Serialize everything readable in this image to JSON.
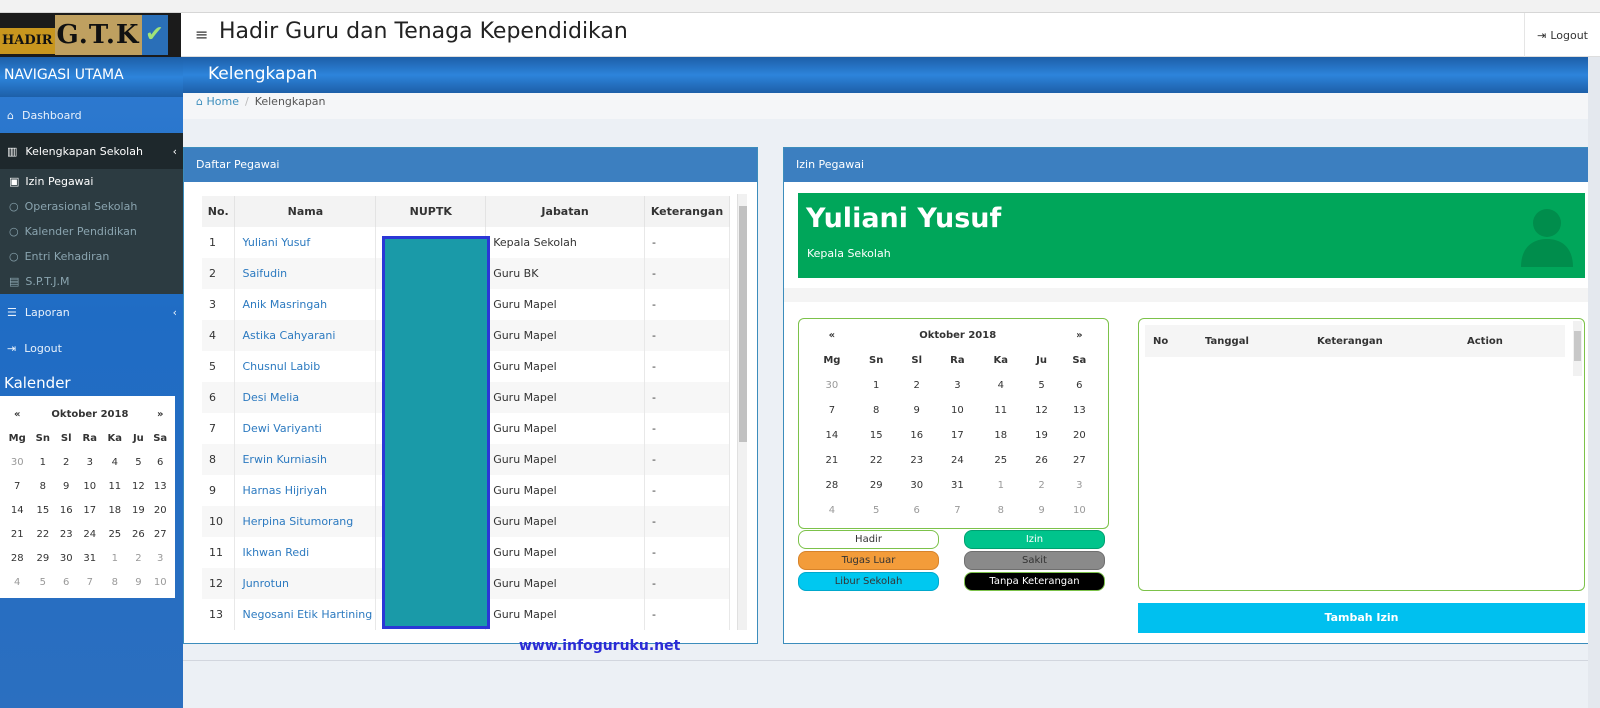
{
  "header": {
    "logo_text1": "HADIR",
    "logo_text2": "G.T.K",
    "title": "Hadir Guru dan Tenaga Kependidikan",
    "logout_label": "Logout"
  },
  "sidebar": {
    "nav_title": "NAVIGASI UTAMA",
    "items": [
      {
        "label": "Dashboard",
        "icon": "home-icon"
      },
      {
        "label": "Kelengkapan Sekolah",
        "icon": "bank-icon"
      },
      {
        "label": "Laporan",
        "icon": "list-icon"
      },
      {
        "label": "Logout",
        "icon": "sign-out-icon"
      }
    ],
    "subitems": [
      {
        "label": "Izin Pegawai",
        "icon": "calendar-check-icon"
      },
      {
        "label": "Operasional Sekolah",
        "icon": "circle-icon"
      },
      {
        "label": "Kalender Pendidikan",
        "icon": "circle-icon"
      },
      {
        "label": "Entri Kehadiran",
        "icon": "circle-icon"
      },
      {
        "label": "S.P.T.J.M",
        "icon": "file-icon"
      }
    ],
    "calendar_title": "Kalender"
  },
  "mini_calendar": {
    "prev": "«",
    "next": "»",
    "month": "Oktober 2018",
    "days": [
      "Mg",
      "Sn",
      "Sl",
      "Ra",
      "Ka",
      "Ju",
      "Sa"
    ],
    "weeks": [
      [
        "30",
        "1",
        "2",
        "3",
        "4",
        "5",
        "6"
      ],
      [
        "7",
        "8",
        "9",
        "10",
        "11",
        "12",
        "13"
      ],
      [
        "14",
        "15",
        "16",
        "17",
        "18",
        "19",
        "20"
      ],
      [
        "21",
        "22",
        "23",
        "24",
        "25",
        "26",
        "27"
      ],
      [
        "28",
        "29",
        "30",
        "31",
        "1",
        "2",
        "3"
      ],
      [
        "4",
        "5",
        "6",
        "7",
        "8",
        "9",
        "10"
      ]
    ]
  },
  "page": {
    "title": "Kelengkapan",
    "breadcrumb_home": "Home",
    "breadcrumb_current": "Kelengkapan"
  },
  "daftar": {
    "title": "Daftar Pegawai",
    "columns": [
      "No.",
      "Nama",
      "NUPTK",
      "Jabatan",
      "Keterangan"
    ],
    "rows": [
      [
        "1",
        "Yuliani Yusuf",
        "",
        "Kepala Sekolah",
        "-"
      ],
      [
        "2",
        "Saifudin",
        "",
        "Guru BK",
        "-"
      ],
      [
        "3",
        "Anik Masringah",
        "",
        "Guru Mapel",
        "-"
      ],
      [
        "4",
        "Astika Cahyarani",
        "",
        "Guru Mapel",
        "-"
      ],
      [
        "5",
        "Chusnul Labib",
        "",
        "Guru Mapel",
        "-"
      ],
      [
        "6",
        "Desi Melia",
        "",
        "Guru Mapel",
        "-"
      ],
      [
        "7",
        "Dewi Variyanti",
        "",
        "Guru Mapel",
        "-"
      ],
      [
        "8",
        "Erwin Kurniasih",
        "",
        "Guru Mapel",
        "-"
      ],
      [
        "9",
        "Harnas Hijriyah",
        "",
        "Guru Mapel",
        "-"
      ],
      [
        "10",
        "Herpina Situmorang",
        "",
        "Guru Mapel",
        "-"
      ],
      [
        "11",
        "Ikhwan Redi",
        "",
        "Guru Mapel",
        "-"
      ],
      [
        "12",
        "Junrotun",
        "",
        "Guru Mapel",
        "-"
      ],
      [
        "13",
        "Negosani Etik Hartining",
        "",
        "Guru Mapel",
        "-"
      ]
    ],
    "watermark": "www.infoguruku.net"
  },
  "izin": {
    "title": "Izin Pegawai",
    "profile_name": "Yuliani Yusuf",
    "profile_role": "Kepala Sekolah",
    "calendar": {
      "prev": "«",
      "next": "»",
      "month": "Oktober 2018",
      "days": [
        "Mg",
        "Sn",
        "Sl",
        "Ra",
        "Ka",
        "Ju",
        "Sa"
      ],
      "weeks": [
        [
          "30",
          "1",
          "2",
          "3",
          "4",
          "5",
          "6"
        ],
        [
          "7",
          "8",
          "9",
          "10",
          "11",
          "12",
          "13"
        ],
        [
          "14",
          "15",
          "16",
          "17",
          "18",
          "19",
          "20"
        ],
        [
          "21",
          "22",
          "23",
          "24",
          "25",
          "26",
          "27"
        ],
        [
          "28",
          "29",
          "30",
          "31",
          "1",
          "2",
          "3"
        ],
        [
          "4",
          "5",
          "6",
          "7",
          "8",
          "9",
          "10"
        ]
      ]
    },
    "legend": [
      {
        "label": "Hadir",
        "bg": "#ffffff",
        "border": "#7cc24a",
        "color": "#333333"
      },
      {
        "label": "Izin",
        "bg": "#00c48c",
        "border": "#00a070",
        "color": "#ffffff"
      },
      {
        "label": "Tugas Luar",
        "bg": "#f39c3a",
        "border": "#d7832a",
        "color": "#333333"
      },
      {
        "label": "Sakit",
        "bg": "#8a8a8a",
        "border": "#6f6f6f",
        "color": "#333333"
      },
      {
        "label": "Libur Sekolah",
        "bg": "#00c8f0",
        "border": "#00a8cc",
        "color": "#333333"
      },
      {
        "label": "Tanpa Keterangan",
        "bg": "#000000",
        "border": "#7cc24a",
        "color": "#ffffff"
      }
    ],
    "table_columns": [
      "No",
      "Tanggal",
      "Keterangan",
      "Action"
    ],
    "add_button": "Tambah Izin"
  },
  "colors": {
    "primary": "#3c7fc0",
    "success": "#00a65a",
    "info": "#00c0ef",
    "sidebar_dark": "#1e282c"
  }
}
